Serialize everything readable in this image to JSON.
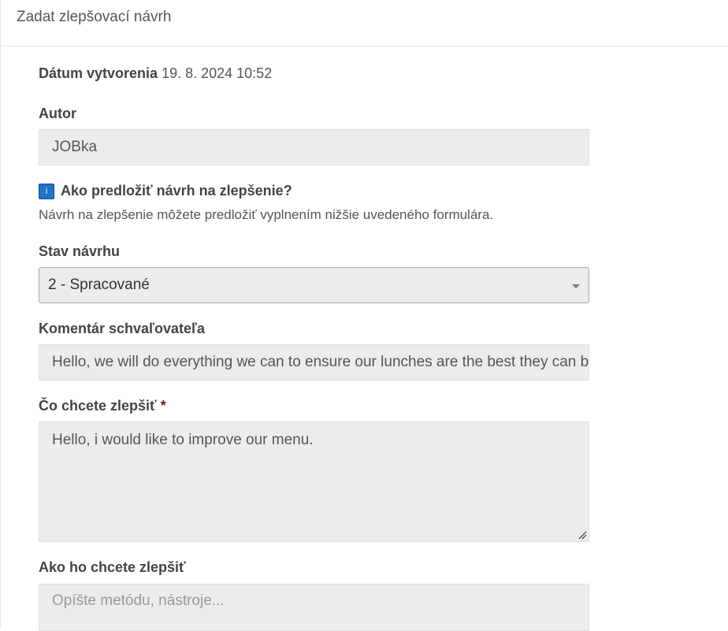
{
  "panel": {
    "title": "Zadat zlepšovací návrh"
  },
  "created": {
    "label": "Dátum vytvorenia",
    "value": "19. 8. 2024 10:52"
  },
  "author": {
    "label": "Autor",
    "value": "JOBka"
  },
  "info": {
    "icon": "info-icon",
    "icon_glyph": "i",
    "title": "Ako predložiť návrh na zlepšenie?",
    "description": "Návrh na zlepšenie môžete predložiť vyplnením nižšie uvedeného formulára."
  },
  "status": {
    "label": "Stav návrhu",
    "selected": "2 - Spracované"
  },
  "approver_comment": {
    "label": "Komentár schvaľovateľa",
    "value": "Hello, we will do everything we can to ensure our lunches are the best they can be."
  },
  "what_improve": {
    "label": "Čo chcete zlepšiť",
    "required_mark": "*",
    "value": "Hello, i would like to improve our menu."
  },
  "how_improve": {
    "label": "Ako ho chcete zlepšiť",
    "placeholder": "Opíšte metódu, nástroje..."
  },
  "colors": {
    "field_bg": "#ececec",
    "required": "#8b1414",
    "info_icon": "#1f73c9"
  }
}
